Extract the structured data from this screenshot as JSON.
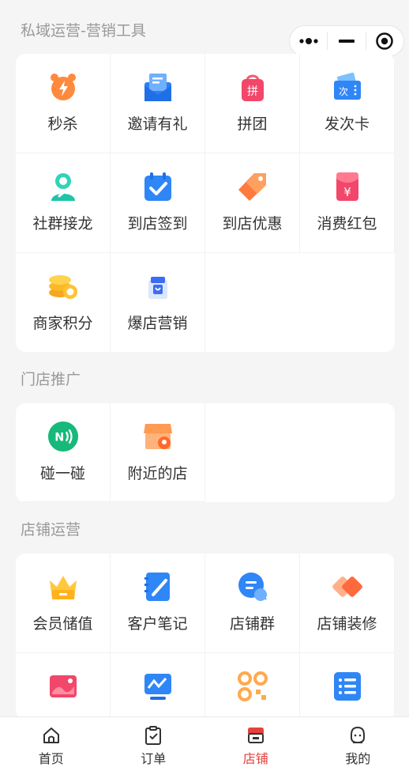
{
  "sections": [
    {
      "title": "私域运营-营销工具",
      "items": [
        {
          "label": "秒杀",
          "icon": "alarm-clock-icon"
        },
        {
          "label": "邀请有礼",
          "icon": "invitation-envelope-icon"
        },
        {
          "label": "拼团",
          "icon": "group-buy-bag-icon"
        },
        {
          "label": "发次卡",
          "icon": "times-card-icon"
        },
        {
          "label": "社群接龙",
          "icon": "community-chain-icon"
        },
        {
          "label": "到店签到",
          "icon": "calendar-check-icon"
        },
        {
          "label": "到店优惠",
          "icon": "discount-tag-icon"
        },
        {
          "label": "消费红包",
          "icon": "red-packet-icon"
        },
        {
          "label": "商家积分",
          "icon": "coin-stack-icon"
        },
        {
          "label": "爆店营销",
          "icon": "shopping-box-icon"
        }
      ]
    },
    {
      "title": "门店推广",
      "items": [
        {
          "label": "碰一碰",
          "icon": "nfc-icon"
        },
        {
          "label": "附近的店",
          "icon": "nearby-store-icon"
        }
      ]
    },
    {
      "title": "店铺运营",
      "items": [
        {
          "label": "会员储值",
          "icon": "member-crown-icon"
        },
        {
          "label": "客户笔记",
          "icon": "notebook-pen-icon"
        },
        {
          "label": "店铺群",
          "icon": "chat-bubble-icon"
        },
        {
          "label": "店铺装修",
          "icon": "decoration-brush-icon"
        },
        {
          "label": "",
          "icon": "picture-icon"
        },
        {
          "label": "",
          "icon": "data-screen-icon"
        },
        {
          "label": "",
          "icon": "qr-code-icon"
        },
        {
          "label": "",
          "icon": "list-icon"
        }
      ]
    }
  ],
  "tabbar": [
    {
      "label": "首页",
      "icon": "home-icon",
      "active": false
    },
    {
      "label": "订单",
      "icon": "order-clipboard-icon",
      "active": false
    },
    {
      "label": "店铺",
      "icon": "store-icon",
      "active": true
    },
    {
      "label": "我的",
      "icon": "profile-icon",
      "active": false
    }
  ],
  "colors": {
    "active_tab": "#e5423c",
    "section_title": "#999999",
    "background": "#f5f5f5"
  }
}
